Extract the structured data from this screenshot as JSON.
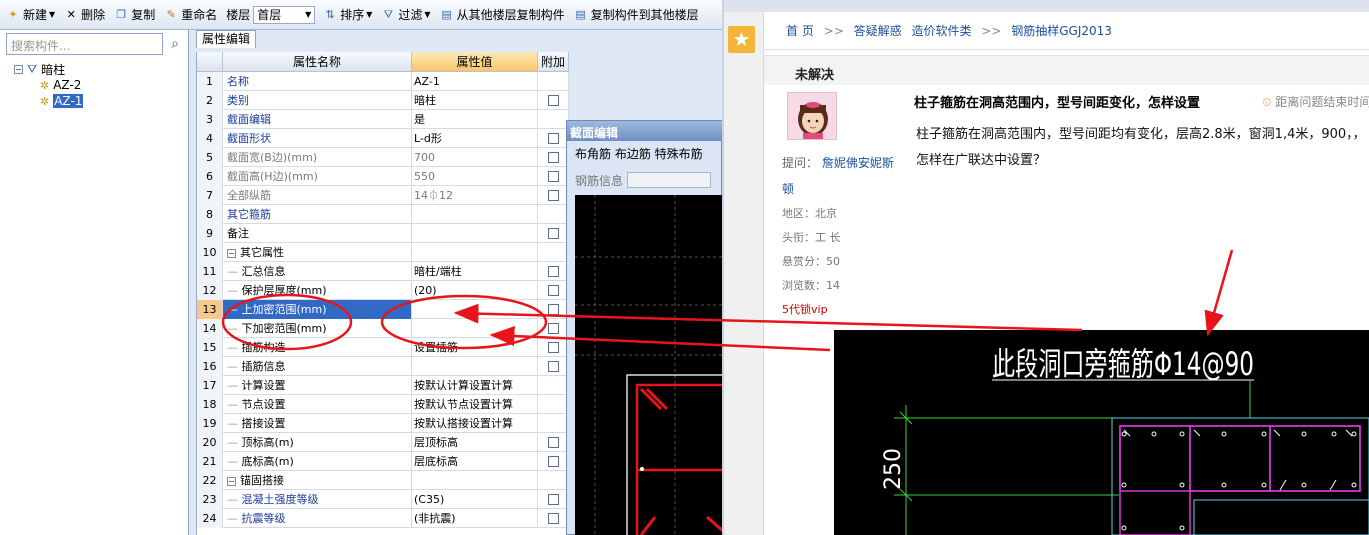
{
  "toolbar": {
    "new": "新建",
    "delete": "删除",
    "copy": "复制",
    "rename": "重命名",
    "floor_label": "楼层",
    "floor_value": "首层",
    "sort": "排序",
    "filter": "过滤",
    "copy_from_floor": "从其他楼层复制构件",
    "copy_to_floor": "复制构件到其他楼层"
  },
  "left": {
    "search_placeholder": "搜索构件...",
    "tree_root": "暗柱",
    "items": [
      "AZ-2",
      "AZ-1"
    ],
    "selected": "AZ-1"
  },
  "tab": "属性编辑",
  "grid": {
    "headers": {
      "name": "属性名称",
      "value": "属性值",
      "attach": "附加"
    },
    "rows": [
      {
        "n": "1",
        "name": "名称",
        "value": "AZ-1",
        "style": "blue",
        "check": false,
        "indent": false
      },
      {
        "n": "2",
        "name": "类别",
        "value": "暗柱",
        "style": "blue",
        "check": true,
        "indent": false
      },
      {
        "n": "3",
        "name": "截面编辑",
        "value": "是",
        "style": "blue",
        "check": false,
        "indent": false
      },
      {
        "n": "4",
        "name": "截面形状",
        "value": "L-d形",
        "style": "blue",
        "check": true,
        "indent": false
      },
      {
        "n": "5",
        "name": "截面宽(B边)(mm)",
        "value": "700",
        "style": "gray",
        "check": true,
        "indent": false
      },
      {
        "n": "6",
        "name": "截面高(H边)(mm)",
        "value": "550",
        "style": "gray",
        "check": true,
        "indent": false
      },
      {
        "n": "7",
        "name": "全部纵筋",
        "value": "14⏀12",
        "style": "gray",
        "check": true,
        "indent": false
      },
      {
        "n": "8",
        "name": "其它箍筋",
        "value": "",
        "style": "blue",
        "check": false,
        "indent": false
      },
      {
        "n": "9",
        "name": "备注",
        "value": "",
        "style": "normal",
        "check": true,
        "indent": false
      },
      {
        "n": "10",
        "name": "其它属性",
        "value": "",
        "style": "group",
        "check": false,
        "indent": false
      },
      {
        "n": "11",
        "name": "汇总信息",
        "value": "暗柱/端柱",
        "style": "normal",
        "check": true,
        "indent": true
      },
      {
        "n": "12",
        "name": "保护层厚度(mm)",
        "value": "(20)",
        "style": "normal",
        "check": true,
        "indent": true
      },
      {
        "n": "13",
        "name": "上加密范围(mm)",
        "value": "",
        "style": "selected",
        "check": true,
        "indent": true
      },
      {
        "n": "14",
        "name": "下加密范围(mm)",
        "value": "",
        "style": "normal",
        "check": true,
        "indent": true
      },
      {
        "n": "15",
        "name": "插筋构造",
        "value": "设置插筋",
        "style": "normal",
        "check": true,
        "indent": true
      },
      {
        "n": "16",
        "name": "插筋信息",
        "value": "",
        "style": "normal",
        "check": true,
        "indent": true
      },
      {
        "n": "17",
        "name": "计算设置",
        "value": "按默认计算设置计算",
        "style": "normal",
        "check": false,
        "indent": true
      },
      {
        "n": "18",
        "name": "节点设置",
        "value": "按默认节点设置计算",
        "style": "normal",
        "check": false,
        "indent": true
      },
      {
        "n": "19",
        "name": "搭接设置",
        "value": "按默认搭接设置计算",
        "style": "normal",
        "check": false,
        "indent": true
      },
      {
        "n": "20",
        "name": "顶标高(m)",
        "value": "层顶标高",
        "style": "normal",
        "check": true,
        "indent": true
      },
      {
        "n": "21",
        "name": "底标高(m)",
        "value": "层底标高",
        "style": "normal",
        "check": true,
        "indent": true
      },
      {
        "n": "22",
        "name": "锚固搭接",
        "value": "",
        "style": "group",
        "check": false,
        "indent": false
      },
      {
        "n": "23",
        "name": "混凝土强度等级",
        "value": "(C35)",
        "style": "blue",
        "check": true,
        "indent": true
      },
      {
        "n": "24",
        "name": "抗震等级",
        "value": "(非抗震)",
        "style": "blue",
        "check": true,
        "indent": true
      }
    ]
  },
  "section_dialog": {
    "title": "截面编辑",
    "tools": "布角筋  布边筋  特殊布筋",
    "info_label": "钢筋信息"
  },
  "browser": {
    "crumbs": [
      "首 页",
      ">>",
      "答疑解惑",
      "造价软件类",
      ">>",
      "钢筋抽样GGJ2013"
    ],
    "status": "未解决",
    "question_title": "柱子箍筋在洞高范围内，型号间距变化，怎样设置",
    "remaining": "距离问题结束时间",
    "question_body": "柱子箍筋在洞高范围内，型号间距均有变化，层高2.8米，窗洞1,4米，900，，怎样在广联达中设置？",
    "asker_label": "提问：",
    "asker_name": "詹妮佛安妮斯顿",
    "region": "地区：北京",
    "title": "头衔：工    长",
    "reward": "悬赏分：50",
    "views": "浏览数：14",
    "vip": "5代锁vip"
  },
  "cad": {
    "annotation": "此段洞口旁箍筋Φ14@90",
    "dimension": "250"
  },
  "colors": {
    "accent": "#316ac5",
    "link": "#1a4f9e",
    "annotation_red": "#e8141c",
    "cad_magenta": "#d63ad6",
    "cad_cyan": "#5ad2e6",
    "cad_green": "#3ccf3c"
  }
}
